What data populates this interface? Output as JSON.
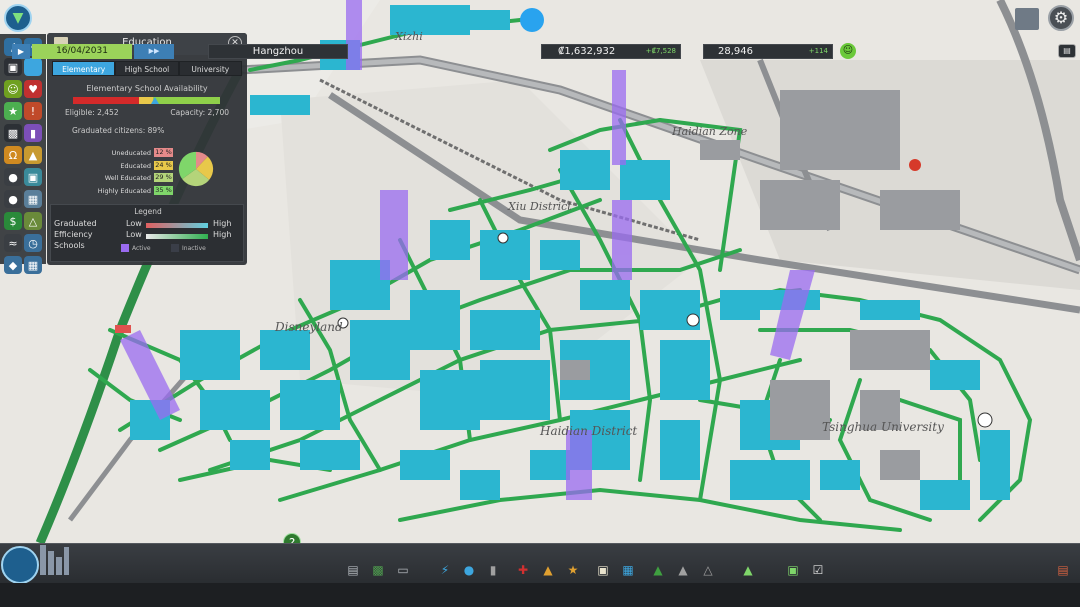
{
  "map": {
    "districts": [
      "Xizhi",
      "Haidian Zone",
      "Xiu District",
      "Disneyland",
      "Haidian District",
      "Tsinghua University"
    ]
  },
  "education_panel": {
    "title": "Education",
    "close_icon": "close-icon",
    "tabs": [
      "Elementary",
      "High School",
      "University"
    ],
    "active_tab": "Elementary",
    "availability_title": "Elementary School Availability",
    "eligible": "Eligible: 2,452",
    "capacity": "Capacity: 2,700",
    "graduated": "Graduated citizens: 89%",
    "breakdown": [
      {
        "label": "Uneducated",
        "value": "12 %",
        "color": "#e58a8a"
      },
      {
        "label": "Educated",
        "value": "24 %",
        "color": "#e8c84a"
      },
      {
        "label": "Well Educated",
        "value": "29 %",
        "color": "#b4d47a"
      },
      {
        "label": "Highly Educated",
        "value": "35 %",
        "color": "#7fd66a"
      }
    ],
    "legend": {
      "title": "Legend",
      "rows": [
        {
          "label": "Graduated",
          "low": "Low",
          "high": "High"
        },
        {
          "label": "Efficiency",
          "low": "Low",
          "high": "High"
        },
        {
          "label": "Schools"
        }
      ],
      "active": "Active",
      "inactive": "Inactive"
    }
  },
  "status_bar": {
    "date": "16/04/2031",
    "city_name": "Hangzhou",
    "money": "₡1,632,932",
    "money_delta": "+₡7,528",
    "population": "28,946",
    "population_delta": "+114",
    "colors": {
      "accent": "#3da6df",
      "date_bg": "#9bd35a",
      "positive": "#7fd66a"
    }
  },
  "toolbar": {
    "icons": [
      "roads-icon",
      "zoning-icon",
      "districts-icon",
      "electricity-icon",
      "water-icon",
      "garbage-icon",
      "healthcare-icon",
      "fire-icon",
      "police-icon",
      "education-icon",
      "public-transport-icon",
      "beautification-icon",
      "monuments-icon",
      "wonders-icon",
      "landscaping-icon",
      "policies-icon"
    ]
  }
}
